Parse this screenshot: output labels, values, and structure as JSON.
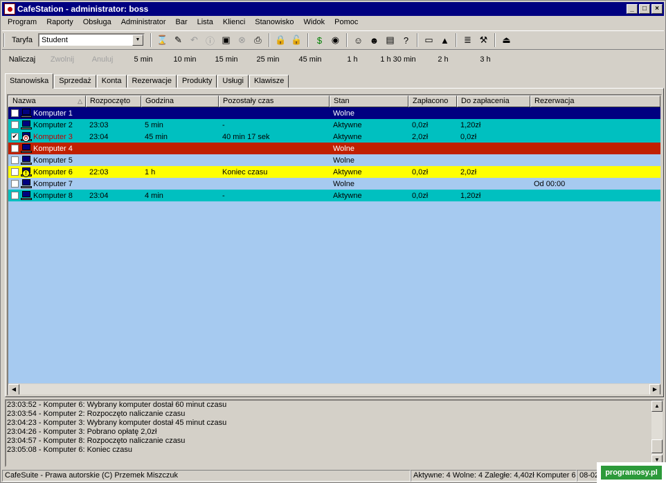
{
  "window": {
    "title": "CafeStation - administrator: boss"
  },
  "menu": [
    "Program",
    "Raporty",
    "Obsługa",
    "Administrator",
    "Bar",
    "Lista",
    "Klienci",
    "Stanowisko",
    "Widok",
    "Pomoc"
  ],
  "toolbar": {
    "tariff_label": "Taryfa",
    "tariff_value": "Student",
    "icons": [
      "hourglass-icon",
      "edit-session-icon",
      "undo-icon",
      "info-icon",
      "image-icon",
      "stop-icon",
      "print-icon",
      "lock-icon",
      "unlock-icon",
      "dollar-icon",
      "coin-icon",
      "user-icon",
      "users-icon",
      "user-card-icon",
      "user-help-icon",
      "monitor-icon",
      "chart-icon",
      "notes-icon",
      "tools-icon",
      "exit-icon"
    ]
  },
  "timebar": {
    "items": [
      {
        "label": "Naliczaj",
        "enabled": true
      },
      {
        "label": "Zwolnij",
        "enabled": false
      },
      {
        "label": "Anuluj",
        "enabled": false
      },
      {
        "label": "5 min",
        "enabled": true
      },
      {
        "label": "10 min",
        "enabled": true
      },
      {
        "label": "15 min",
        "enabled": true
      },
      {
        "label": "25 min",
        "enabled": true
      },
      {
        "label": "45 min",
        "enabled": true
      },
      {
        "label": "1 h",
        "enabled": true
      },
      {
        "label": "1 h 30 min",
        "enabled": true
      },
      {
        "label": "2 h",
        "enabled": true
      },
      {
        "label": "3 h",
        "enabled": true
      }
    ]
  },
  "tabs": [
    "Stanowiska",
    "Sprzedaż",
    "Konta",
    "Rezerwacje",
    "Produkty",
    "Usługi",
    "Klawisze"
  ],
  "table": {
    "columns": [
      "Nazwa",
      "Rozpoczęto",
      "Godzina",
      "Pozostały czas",
      "Stan",
      "Zapłacono",
      "Do zapłacenia",
      "Rezerwacja"
    ],
    "rows": [
      {
        "name": "Komputer 1",
        "start": "",
        "hour": "",
        "remaining": "",
        "state": "Wolne",
        "paid": "",
        "due": "",
        "reservation": "",
        "checked": false,
        "bg": "#000080",
        "fg": "#ffffff",
        "badge": ""
      },
      {
        "name": "Komputer 2",
        "start": "23:03",
        "hour": "5 min",
        "remaining": "-",
        "state": "Aktywne",
        "paid": "0,0zł",
        "due": "1,20zł",
        "reservation": "",
        "checked": false,
        "bg": "#00c0c0",
        "fg": "#000000",
        "badge": ""
      },
      {
        "name": "Komputer 3",
        "start": "23:04",
        "hour": "45 min",
        "remaining": "40 min 17 sek",
        "state": "Aktywne",
        "paid": "2,0zł",
        "due": "0,0zł",
        "reservation": "",
        "checked": true,
        "bg": "#00c0c0",
        "fg": "#000000",
        "badge": "alarm"
      },
      {
        "name": "Komputer 4",
        "start": "",
        "hour": "",
        "remaining": "",
        "state": "Wolne",
        "paid": "",
        "due": "",
        "reservation": "",
        "checked": false,
        "bg": "#c02000",
        "fg": "#ffffff",
        "badge": ""
      },
      {
        "name": "Komputer 5",
        "start": "",
        "hour": "",
        "remaining": "",
        "state": "Wolne",
        "paid": "",
        "due": "",
        "reservation": "",
        "checked": false,
        "bg": "#a6caf0",
        "fg": "#000000",
        "badge": ""
      },
      {
        "name": "Komputer 6",
        "start": "22:03",
        "hour": "1 h",
        "remaining": "Koniec czasu",
        "state": "Aktywne",
        "paid": "0,0zł",
        "due": "2,0zł",
        "reservation": "",
        "checked": false,
        "bg": "#ffff00",
        "fg": "#000000",
        "badge": "warning"
      },
      {
        "name": "Komputer 7",
        "start": "",
        "hour": "",
        "remaining": "",
        "state": "Wolne",
        "paid": "",
        "due": "",
        "reservation": "Od 00:00",
        "checked": false,
        "bg": "#a6caf0",
        "fg": "#000000",
        "badge": ""
      },
      {
        "name": "Komputer 8",
        "start": "23:04",
        "hour": "4 min",
        "remaining": "-",
        "state": "Aktywne",
        "paid": "0,0zł",
        "due": "1,20zł",
        "reservation": "",
        "checked": false,
        "bg": "#00c0c0",
        "fg": "#000000",
        "badge": ""
      }
    ]
  },
  "log": [
    "23:03:52 - Komputer 6: Wybrany komputer dostał 60 minut czasu",
    "23:03:54 - Komputer 2: Rozpoczęto naliczanie czasu",
    "23:04:23 - Komputer 3: Wybrany komputer dostał 45 minut czasu",
    "23:04:26 - Komputer 3: Pobrano opłatę 2,0zł",
    "23:04:57 - Komputer 8: Rozpoczęto naliczanie czasu",
    "23:05:08 - Komputer 6: Koniec czasu"
  ],
  "statusbar": {
    "copyright": "CafeSuite - Prawa autorskie (C) Przemek Miszczuk",
    "summary": "Aktywne: 4 Wolne: 4 Zaległe: 4,40zł Komputer 6",
    "date": "08-02"
  },
  "watermark": "programosy.pl"
}
